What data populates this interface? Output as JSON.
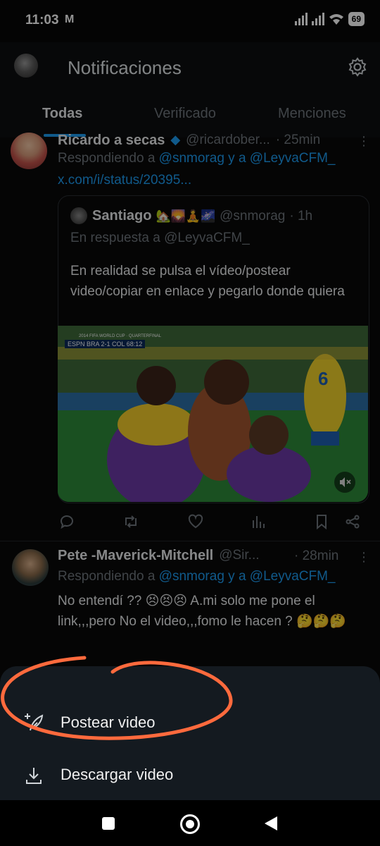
{
  "status_bar": {
    "time": "11:03",
    "carrier_icon": "M",
    "battery": "69"
  },
  "header": {
    "title": "Notificaciones"
  },
  "tabs": [
    {
      "label": "Todas"
    },
    {
      "label": "Verificado"
    },
    {
      "label": "Menciones"
    }
  ],
  "posts": [
    {
      "name": "Ricardo a secas",
      "handle": "@ricardober...",
      "time": "· 25min",
      "replying_prefix": "Respondiendo a",
      "replying_users": "@snmorag y a @LeyvaCFM_",
      "link": "x.com/i/status/20395...",
      "quote": {
        "name": "Santiago",
        "name_emojis": "🏡🌄🧘🌌",
        "handle": "@snmorag",
        "time": "· 1h",
        "reply_line": "En respuesta a @LeyvaCFM_",
        "text": "En realidad se pulsa el vídeo/postear video/copiar en enlace y pegarlo donde quiera",
        "video": {
          "scorebug": "BRA 2-1 COL",
          "clock": "68:12",
          "broadcaster": "ESPN",
          "tournament": "2014 FIFA WORLD CUP · QUARTERFINAL",
          "jersey_number": "6",
          "muted_icon": "speaker-muted-icon"
        }
      }
    },
    {
      "name": "Pete -Maverick-Mitchell",
      "handle": "@Sir...",
      "time": "· 28min",
      "replying_prefix": "Respondiendo a",
      "replying_users": "@snmorag y a @LeyvaCFM_",
      "text": "No entendí ?? 😣😣😣 A.mi solo me pone el link,,,pero No el video,,,fomo le hacen ? 🤔🤔🤔"
    }
  ],
  "sheet": {
    "items": [
      {
        "label": "Postear video",
        "icon": "feather-plus-icon"
      },
      {
        "label": "Descargar video",
        "icon": "download-icon"
      }
    ]
  },
  "colors": {
    "accent": "#1d9bf0",
    "annotation": "#ff6a3d",
    "sheet": "#141a20"
  }
}
